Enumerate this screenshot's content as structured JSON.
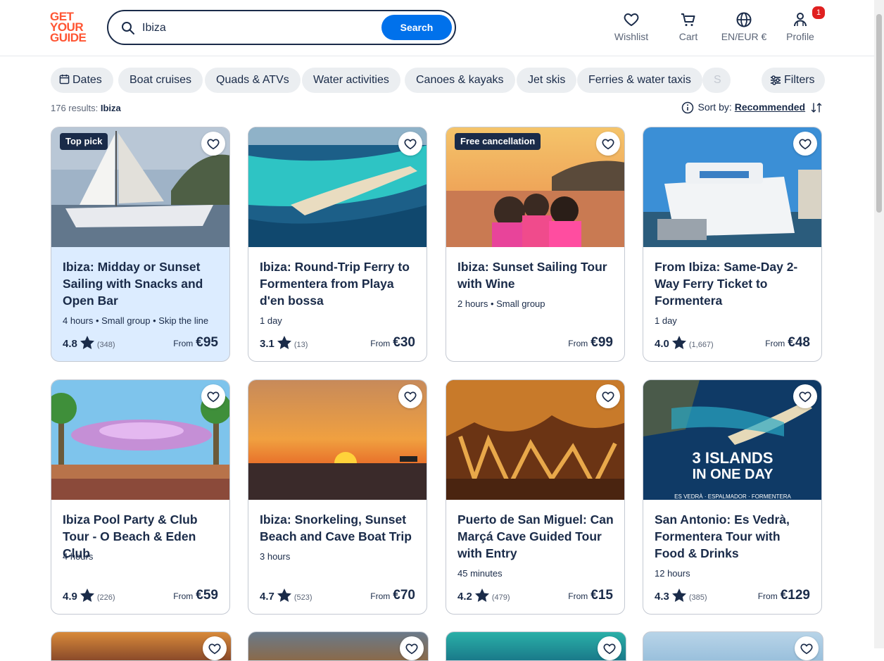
{
  "logo": {
    "line1": "GET",
    "line2": "YOUR",
    "line3": "GUIDE"
  },
  "search": {
    "value": "Ibiza",
    "button": "Search"
  },
  "nav": {
    "wishlist": "Wishlist",
    "cart": "Cart",
    "locale": "EN/EUR €",
    "profile": "Profile",
    "profile_badge": "1"
  },
  "chips": [
    "Dates",
    "Boat cruises",
    "Quads & ATVs",
    "Water activities",
    "Canoes & kayaks",
    "Jet skis",
    "Ferries & water taxis",
    "S"
  ],
  "filters_label": "Filters",
  "results": {
    "count": "176 results:",
    "query": "Ibiza"
  },
  "sort": {
    "label": "Sort by:",
    "value": "Recommended"
  },
  "cards": [
    {
      "tag": "Top pick",
      "title": "Ibiza: Midday or Sunset Sailing with Snacks and Open Bar",
      "meta": "4 hours • Small group • Skip the line",
      "rating": "4.8",
      "reviews": "(348)",
      "from": "From",
      "price": "€95"
    },
    {
      "tag": "",
      "title": "Ibiza: Round-Trip Ferry to Formentera from Playa d'en bossa",
      "meta": "1 day",
      "rating": "3.1",
      "reviews": "(13)",
      "from": "From",
      "price": "€30"
    },
    {
      "tag": "Free cancellation",
      "title": "Ibiza: Sunset Sailing Tour with Wine",
      "meta": "2 hours • Small group",
      "rating": "",
      "reviews": "",
      "from": "From",
      "price": "€99"
    },
    {
      "tag": "",
      "title": "From Ibiza: Same-Day 2-Way Ferry Ticket to Formentera",
      "meta": "1 day",
      "rating": "4.0",
      "reviews": "(1,667)",
      "from": "From",
      "price": "€48"
    },
    {
      "tag": "",
      "title": "Ibiza Pool Party & Club Tour - O Beach & Eden Club",
      "meta": "4 hours",
      "rating": "4.9",
      "reviews": "(226)",
      "from": "From",
      "price": "€59"
    },
    {
      "tag": "",
      "title": "Ibiza: Snorkeling, Sunset Beach and Cave Boat Trip",
      "meta": "3 hours",
      "rating": "4.7",
      "reviews": "(523)",
      "from": "From",
      "price": "€70"
    },
    {
      "tag": "",
      "title": "Puerto de San Miguel: Can Marçá Cave Guided Tour with Entry",
      "meta": "45 minutes",
      "rating": "4.2",
      "reviews": "(479)",
      "from": "From",
      "price": "€15"
    },
    {
      "tag": "",
      "title": "San Antonio: Es Vedrà, Formentera Tour with Food & Drinks",
      "meta": "12 hours",
      "rating": "4.3",
      "reviews": "(385)",
      "from": "From",
      "price": "€129"
    }
  ],
  "image_overlay": {
    "line1": "3 ISLANDS",
    "line2": "IN ONE DAY",
    "line3": "ES VEDRÀ · ESPALMADOR · FORMENTERA"
  },
  "colors": {
    "brand": "#ff5533",
    "primary": "#0071eb",
    "navy": "#1a2b49",
    "chip_bg": "#ebeef1",
    "highlight": "#dcecff"
  }
}
